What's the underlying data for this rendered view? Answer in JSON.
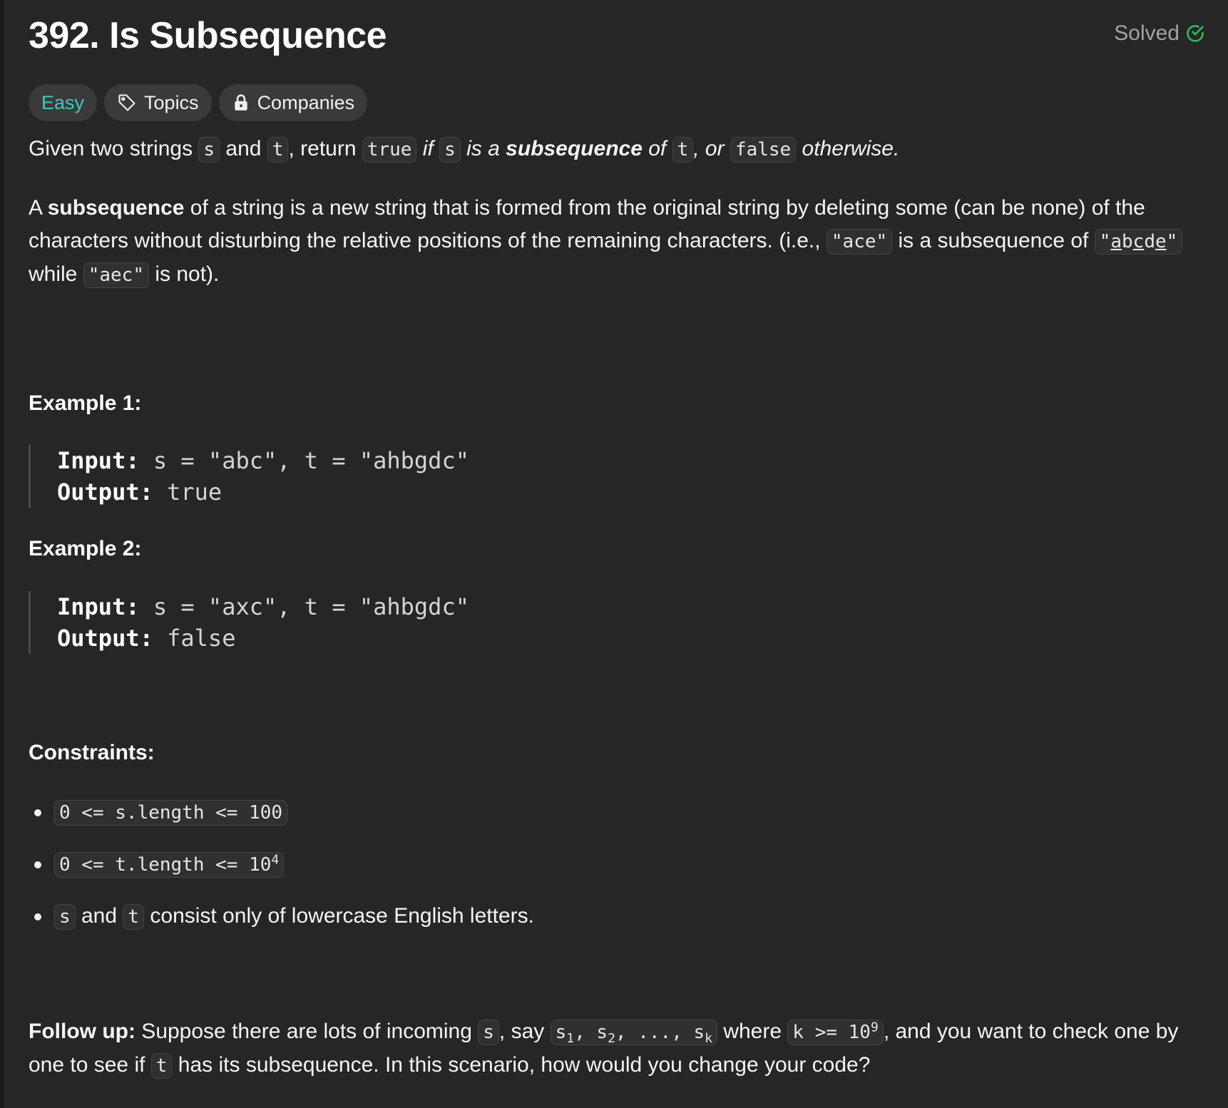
{
  "problem": {
    "title": "392. Is Subsequence",
    "status": "Solved",
    "difficulty": "Easy",
    "topics_label": "Topics",
    "companies_label": "Companies"
  },
  "description": {
    "p1": {
      "t1": "Given two strings ",
      "c1": "s",
      "t2": " and ",
      "c2": "t",
      "t3": ", return ",
      "c3": "true",
      "t4": " if ",
      "c4": "s",
      "t5": " is a ",
      "b1": "subsequence",
      "t6": " of ",
      "c5": "t",
      "t7": ", or ",
      "c6": "false",
      "t8": " otherwise."
    },
    "p2": {
      "t1": "A ",
      "b1": "subsequence",
      "t2": " of a string is a new string that is formed from the original string by deleting some (can be none) of the characters without disturbing the relative positions of the remaining characters. (i.e., ",
      "c1": "\"ace\"",
      "t3": " is a subsequence of ",
      "c2_a": "\"",
      "c2_b": "a",
      "c2_c": "b",
      "c2_d": "c",
      "c2_e": "d",
      "c2_f": "e",
      "c2_g": "\"",
      "t4": " while ",
      "c3": "\"aec\"",
      "t5": " is not)."
    }
  },
  "examples": [
    {
      "heading": "Example 1:",
      "input_label": "Input:",
      "input_value": "s = \"abc\", t = \"ahbgdc\"",
      "output_label": "Output:",
      "output_value": "true"
    },
    {
      "heading": "Example 2:",
      "input_label": "Input:",
      "input_value": "s = \"axc\", t = \"ahbgdc\"",
      "output_label": "Output:",
      "output_value": "false"
    }
  ],
  "constraints": {
    "heading": "Constraints:",
    "c1": "0 <= s.length <= 100",
    "c2_base": "0 <= t.length <= 10",
    "c2_exp": "4",
    "c3_a": "s",
    "c3_b": " and ",
    "c3_c": "t",
    "c3_d": " consist only of lowercase English letters."
  },
  "followup": {
    "label": "Follow up:",
    "t1": " Suppose there are lots of incoming ",
    "c1": "s",
    "t2": ", say ",
    "c2_s1": "s",
    "c2_sub1": "1",
    "c2_sep1": ", s",
    "c2_sub2": "2",
    "c2_sep2": ", ..., s",
    "c2_subk": "k",
    "t3": " where ",
    "c3_base": "k >= 10",
    "c3_exp": "9",
    "t4": ", and you want to check one by one to see if ",
    "c4": "t",
    "t5": " has its subsequence. In this scenario, how would you change your code?"
  },
  "colors": {
    "background": "#262626",
    "easy": "#46c6c2",
    "solved_check": "#2cbb5d",
    "chip_bg": "#3a3a3a"
  },
  "icons": [
    "check-circle-icon",
    "tag-icon",
    "lock-icon"
  ]
}
